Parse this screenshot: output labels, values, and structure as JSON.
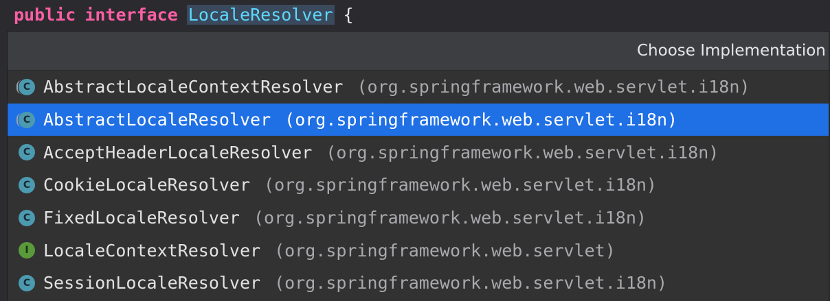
{
  "editor": {
    "keyword_public": "public",
    "keyword_interface": "interface",
    "type_name": "LocaleResolver",
    "open_brace": "{"
  },
  "popup": {
    "title": "Choose Implementation",
    "items": [
      {
        "name": "AbstractLocaleContextResolver",
        "package": "(org.springframework.web.servlet.i18n)",
        "icon": "abstract-class-icon",
        "selected": false
      },
      {
        "name": "AbstractLocaleResolver",
        "package": "(org.springframework.web.servlet.i18n)",
        "icon": "abstract-class-icon",
        "selected": true
      },
      {
        "name": "AcceptHeaderLocaleResolver",
        "package": "(org.springframework.web.servlet.i18n)",
        "icon": "class-icon",
        "selected": false
      },
      {
        "name": "CookieLocaleResolver",
        "package": "(org.springframework.web.servlet.i18n)",
        "icon": "class-icon",
        "selected": false
      },
      {
        "name": "FixedLocaleResolver",
        "package": "(org.springframework.web.servlet.i18n)",
        "icon": "class-icon",
        "selected": false
      },
      {
        "name": "LocaleContextResolver",
        "package": "(org.springframework.web.servlet)",
        "icon": "interface-icon",
        "selected": false
      },
      {
        "name": "SessionLocaleResolver",
        "package": "(org.springframework.web.servlet.i18n)",
        "icon": "class-icon",
        "selected": false
      }
    ],
    "icon_letters": {
      "class": "C",
      "interface": "I"
    }
  },
  "colors": {
    "keyword": "#fc5fa3",
    "type": "#5dd8ff",
    "selection": "#1f6fe5",
    "class_icon": "#4c9ab0",
    "interface_icon": "#5a9a3a"
  }
}
